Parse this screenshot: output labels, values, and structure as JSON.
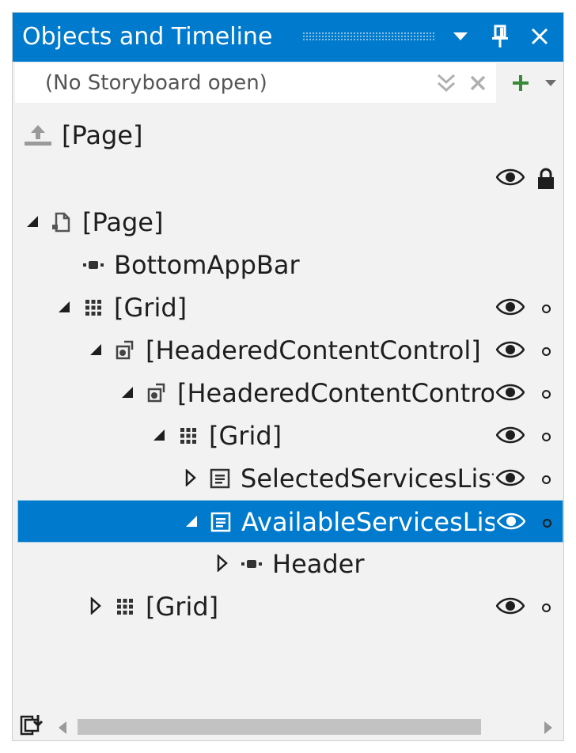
{
  "window": {
    "title": "Objects and Timeline"
  },
  "storyboard": {
    "value": "(No Storyboard open)"
  },
  "root": {
    "label": "[Page]"
  },
  "tree": [
    {
      "label": "[Page]",
      "indent": 0,
      "expander": "expanded",
      "icon": "page-icon",
      "eye": false,
      "dot": false
    },
    {
      "label": "BottomAppBar",
      "indent": 1,
      "expander": "none",
      "icon": "element-icon",
      "eye": false,
      "dot": false
    },
    {
      "label": "[Grid]",
      "indent": 1,
      "expander": "expanded",
      "icon": "grid-icon",
      "eye": true,
      "dot": true
    },
    {
      "label": "[HeaderedContentControl]",
      "indent": 2,
      "expander": "expanded",
      "icon": "content-control-icon",
      "eye": true,
      "dot": true
    },
    {
      "label": "[HeaderedContentControl]",
      "indent": 3,
      "expander": "expanded",
      "icon": "content-control-icon",
      "eye": true,
      "dot": true
    },
    {
      "label": "[Grid]",
      "indent": 4,
      "expander": "expanded",
      "icon": "grid-icon",
      "eye": true,
      "dot": true
    },
    {
      "label": "SelectedServicesListView",
      "indent": 5,
      "expander": "collapsed",
      "icon": "list-icon",
      "eye": true,
      "dot": true
    },
    {
      "label": "AvailableServicesListView",
      "indent": 5,
      "expander": "expanded",
      "icon": "list-icon",
      "eye": true,
      "dot": true,
      "selected": true
    },
    {
      "label": "Header",
      "indent": 6,
      "expander": "collapsed",
      "icon": "element-icon",
      "eye": false,
      "dot": false
    },
    {
      "label": "[Grid]",
      "indent": 2,
      "expander": "collapsed",
      "icon": "grid-icon",
      "eye": true,
      "dot": true
    }
  ],
  "colors": {
    "accent": "#007acc",
    "panel_bg": "#f2f2f2",
    "add_green": "#388a34"
  }
}
